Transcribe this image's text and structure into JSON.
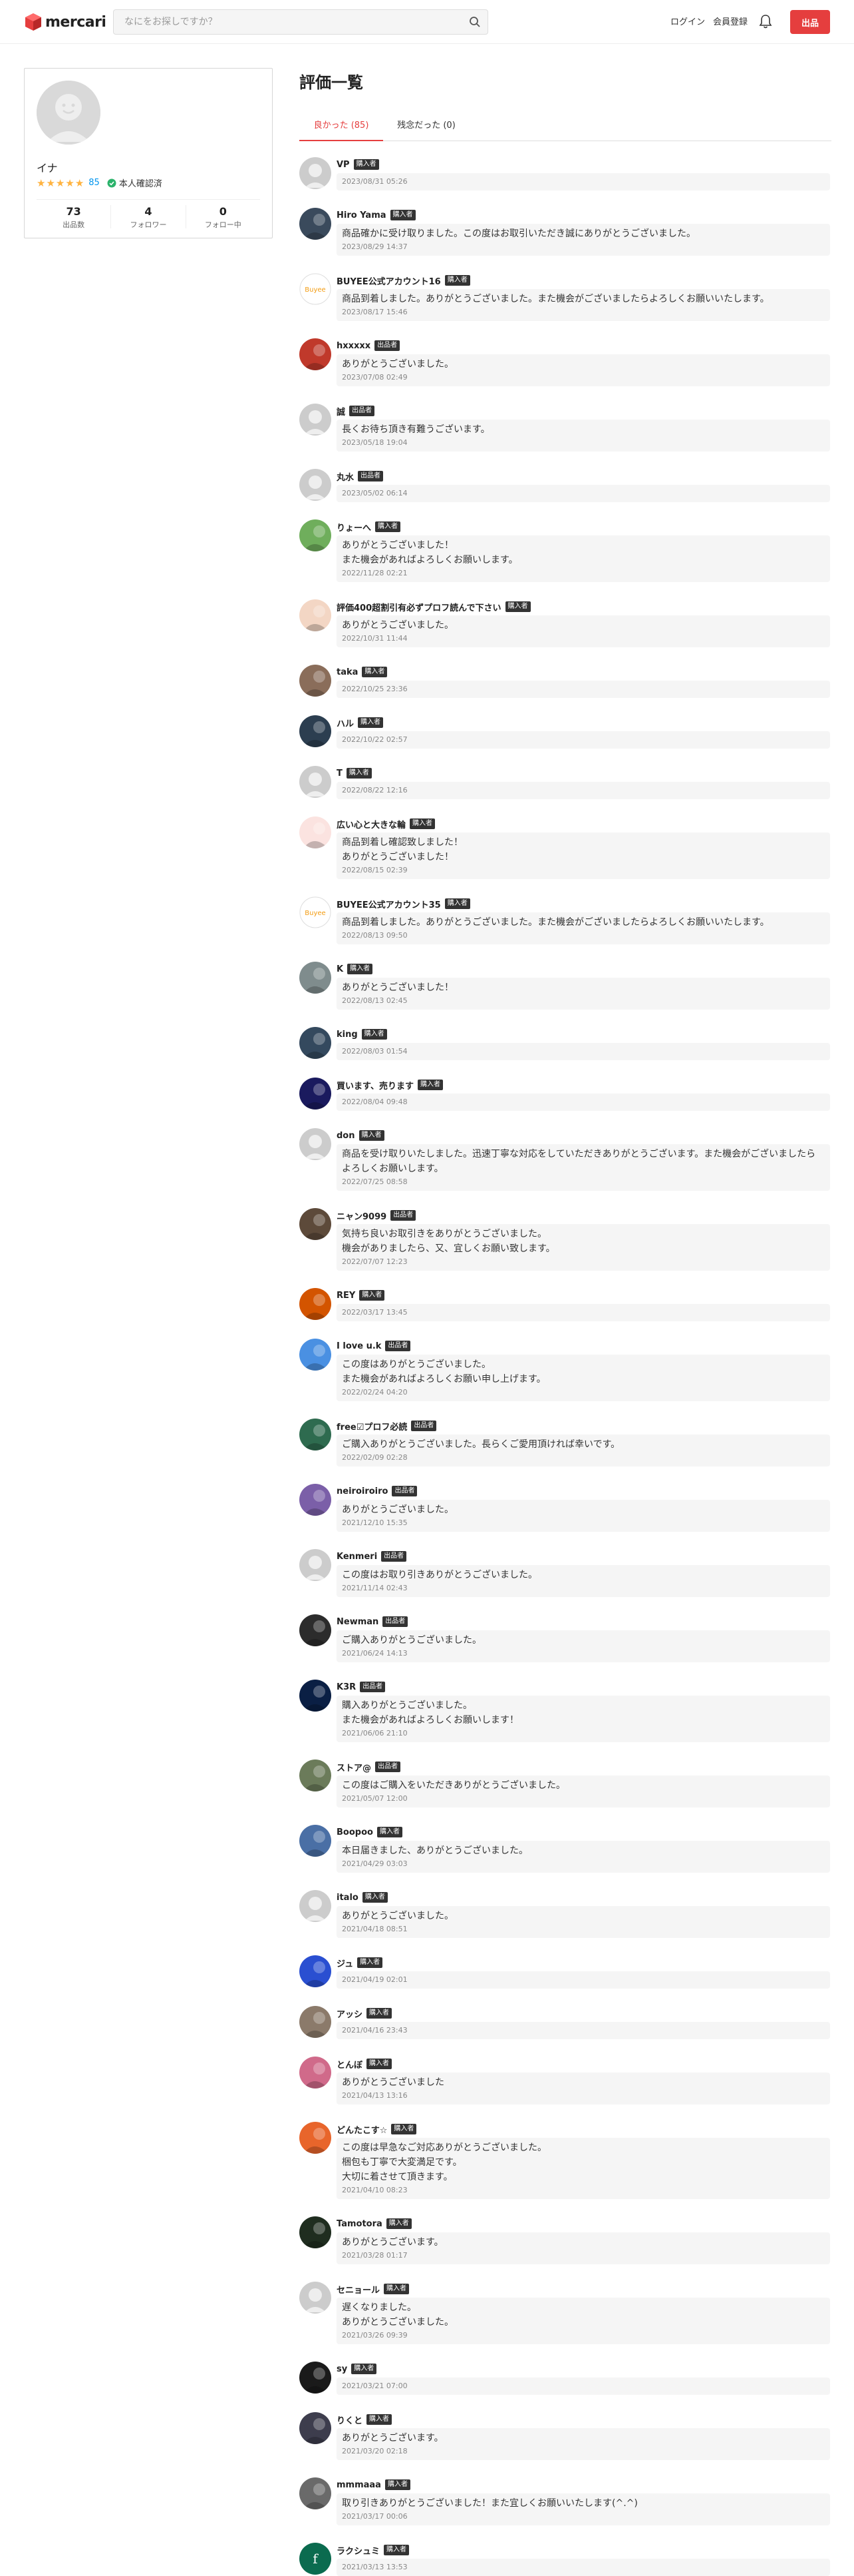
{
  "header": {
    "logo_text": "mercari",
    "search_placeholder": "なにをお探しですか？",
    "login": "ログイン",
    "signup": "会員登録",
    "listing": "出品",
    "brand_color": "#e53e3e"
  },
  "profile": {
    "name": "イナ",
    "rating_count": "85",
    "verified_label": "本人確認済",
    "stats": [
      {
        "num": "73",
        "label": "出品数"
      },
      {
        "num": "4",
        "label": "フォロワー"
      },
      {
        "num": "0",
        "label": "フォロー中"
      }
    ]
  },
  "page_title": "評価一覧",
  "tabs": [
    {
      "label": "良かった (85)",
      "active": true
    },
    {
      "label": "残念だった (0)",
      "active": false
    }
  ],
  "reviews": [
    {
      "name": "VP",
      "role": "購入者",
      "text": "",
      "date": "2023/08/31 05:26",
      "avatar": "#cccccc",
      "icon": "default-avatar-icon"
    },
    {
      "name": "Hiro Yama",
      "role": "購入者",
      "text": "商品確かに受け取りました。この度はお取引いただき誠にありがとうございました。",
      "date": "2023/08/29 14:37",
      "avatar": "#3a4a5c",
      "icon": "user-photo-icon"
    },
    {
      "name": "BUYEE公式アカウント16",
      "role": "購入者",
      "text": "商品到着しました。ありがとうございました。また機会がございましたらよろしくお願いいたします。",
      "date": "2023/08/17 15:46",
      "avatar": "#ffffff",
      "icon": "buyee-logo-icon"
    },
    {
      "name": "hxxxxx",
      "role": "出品者",
      "text": "ありがとうございました。",
      "date": "2023/07/08 02:49",
      "avatar": "#c0392b",
      "icon": "user-photo-icon"
    },
    {
      "name": "誠",
      "role": "出品者",
      "text": "長くお待ち頂き有難うございます。",
      "date": "2023/05/18 19:04",
      "avatar": "#cccccc",
      "icon": "default-avatar-icon"
    },
    {
      "name": "丸水",
      "role": "出品者",
      "text": "",
      "date": "2023/05/02 06:14",
      "avatar": "#cccccc",
      "icon": "default-avatar-icon"
    },
    {
      "name": "りょーへ",
      "role": "購入者",
      "text": "ありがとうございました！\nまた機会があればよろしくお願いします。",
      "date": "2022/11/28 02:21",
      "avatar": "#6fae5c",
      "icon": "user-photo-icon"
    },
    {
      "name": "評価400超割引有必ずプロフ読んで下さい",
      "role": "購入者",
      "text": "ありがとうございました。",
      "date": "2022/10/31 11:44",
      "avatar": "#f3d6c4",
      "icon": "user-photo-icon"
    },
    {
      "name": "taka",
      "role": "購入者",
      "text": "",
      "date": "2022/10/25 23:36",
      "avatar": "#8a6d5a",
      "icon": "user-photo-icon"
    },
    {
      "name": "ハル",
      "role": "購入者",
      "text": "",
      "date": "2022/10/22 02:57",
      "avatar": "#2c3e50",
      "icon": "user-photo-icon"
    },
    {
      "name": "T",
      "role": "購入者",
      "text": "",
      "date": "2022/08/22 12:16",
      "avatar": "#cccccc",
      "icon": "default-avatar-icon"
    },
    {
      "name": "広い心と大きな輪",
      "role": "購入者",
      "text": "商品到着し確認致しました！\nありがとうございました！",
      "date": "2022/08/15 02:39",
      "avatar": "#fbe3e0",
      "icon": "user-photo-icon"
    },
    {
      "name": "BUYEE公式アカウント35",
      "role": "購入者",
      "text": "商品到着しました。ありがとうございました。また機会がございましたらよろしくお願いいたします。",
      "date": "2022/08/13 09:50",
      "avatar": "#ffffff",
      "icon": "buyee-logo-icon"
    },
    {
      "name": "K",
      "role": "購入者",
      "text": "ありがとうございました！",
      "date": "2022/08/13 02:45",
      "avatar": "#7f8c8d",
      "icon": "user-photo-icon"
    },
    {
      "name": "king",
      "role": "購入者",
      "text": "",
      "date": "2022/08/03 01:54",
      "avatar": "#34495e",
      "icon": "user-photo-icon"
    },
    {
      "name": "買います、売ります",
      "role": "購入者",
      "text": "",
      "date": "2022/08/04 09:48",
      "avatar": "#1a1a5e",
      "icon": "user-photo-icon"
    },
    {
      "name": "don",
      "role": "購入者",
      "text": "商品を受け取りいたしました。迅速丁寧な対応をしていただきありがとうございます。また機会がございましたらよろしくお願いします。",
      "date": "2022/07/25 08:58",
      "avatar": "#cccccc",
      "icon": "default-avatar-icon"
    },
    {
      "name": "ニャン9099",
      "role": "出品者",
      "text": "気持ち良いお取引きをありがとうございました。\n機会がありましたら、又、宜しくお願い致します。",
      "date": "2022/07/07 12:23",
      "avatar": "#5d4a3a",
      "icon": "user-photo-icon"
    },
    {
      "name": "REY",
      "role": "購入者",
      "text": "",
      "date": "2022/03/17 13:45",
      "avatar": "#d35400",
      "icon": "user-photo-icon"
    },
    {
      "name": "I love u.k",
      "role": "出品者",
      "text": "この度はありがとうございました。\nまた機会があればよろしくお願い申し上げます。",
      "date": "2022/02/24 04:20",
      "avatar": "#4a90e2",
      "icon": "user-photo-icon"
    },
    {
      "name": "free☑プロフ必読",
      "role": "出品者",
      "text": "ご購入ありがとうございました。長らくご愛用頂ければ幸いです。",
      "date": "2022/02/09 02:28",
      "avatar": "#2e6b4f",
      "icon": "user-photo-icon"
    },
    {
      "name": "neiroiroiro",
      "role": "出品者",
      "text": "ありがとうございました。",
      "date": "2021/12/10 15:35",
      "avatar": "#7b5fa8",
      "icon": "user-photo-icon"
    },
    {
      "name": "Kenmeri",
      "role": "出品者",
      "text": "この度はお取り引きありがとうございました。",
      "date": "2021/11/14 02:43",
      "avatar": "#cccccc",
      "icon": "default-avatar-icon"
    },
    {
      "name": "Newman",
      "role": "出品者",
      "text": "ご購入ありがとうございました。",
      "date": "2021/06/24 14:13",
      "avatar": "#2c2c2c",
      "icon": "user-photo-icon"
    },
    {
      "name": "K3R",
      "role": "出品者",
      "text": "購入ありがとうございました。\nまた機会があればよろしくお願いします！",
      "date": "2021/06/06 21:10",
      "avatar": "#0a1f44",
      "icon": "user-photo-icon"
    },
    {
      "name": "ストア@",
      "role": "出品者",
      "text": "この度はご購入をいただきありがとうございました。",
      "date": "2021/05/07 12:00",
      "avatar": "#6b7b5a",
      "icon": "user-photo-icon"
    },
    {
      "name": "Boopoo",
      "role": "購入者",
      "text": "本日届きました、ありがとうございました。",
      "date": "2021/04/29 03:03",
      "avatar": "#4a6fa5",
      "icon": "user-photo-icon"
    },
    {
      "name": "italo",
      "role": "購入者",
      "text": "ありがとうございました。",
      "date": "2021/04/18 08:51",
      "avatar": "#cccccc",
      "icon": "default-avatar-icon"
    },
    {
      "name": "ジュ",
      "role": "購入者",
      "text": "",
      "date": "2021/04/19 02:01",
      "avatar": "#2a4fd1",
      "icon": "user-photo-icon"
    },
    {
      "name": "アッシ",
      "role": "購入者",
      "text": "",
      "date": "2021/04/16 23:43",
      "avatar": "#8b7a6a",
      "icon": "user-photo-icon"
    },
    {
      "name": "とんぼ",
      "role": "購入者",
      "text": "ありがとうございました",
      "date": "2021/04/13 13:16",
      "avatar": "#d06a8a",
      "icon": "user-photo-icon"
    },
    {
      "name": "どんたこす☆",
      "role": "購入者",
      "text": "この度は早急なご対応ありがとうございました。\n梱包も丁寧で大変満足です。\n大切に着させて頂きます。",
      "date": "2021/04/10 08:23",
      "avatar": "#e8652b",
      "icon": "user-photo-icon"
    },
    {
      "name": "Tamotora",
      "role": "購入者",
      "text": "ありがとうございます。",
      "date": "2021/03/28 01:17",
      "avatar": "#1f2d1f",
      "icon": "user-photo-icon"
    },
    {
      "name": "セニョール",
      "role": "購入者",
      "text": "遅くなりました。\nありがとうございました。",
      "date": "2021/03/26 09:39",
      "avatar": "#cccccc",
      "icon": "default-avatar-icon"
    },
    {
      "name": "sy",
      "role": "購入者",
      "text": "",
      "date": "2021/03/21 07:00",
      "avatar": "#1a1a1a",
      "icon": "user-photo-icon"
    },
    {
      "name": "りくと",
      "role": "購入者",
      "text": "ありがとうございます。",
      "date": "2021/03/20 02:18",
      "avatar": "#3d3d4d",
      "icon": "user-photo-icon"
    },
    {
      "name": "mmmaaa",
      "role": "購入者",
      "text": "取り引きありがとうございました！また宜しくお願いいたします(^.^)",
      "date": "2021/03/17 00:06",
      "avatar": "#6a6a6a",
      "icon": "user-photo-icon"
    },
    {
      "name": "ラクシュミ",
      "role": "購入者",
      "text": "",
      "date": "2021/03/13 13:53",
      "avatar": "#0b6b4f",
      "icon": "user-initial-icon",
      "initial": "f"
    }
  ]
}
